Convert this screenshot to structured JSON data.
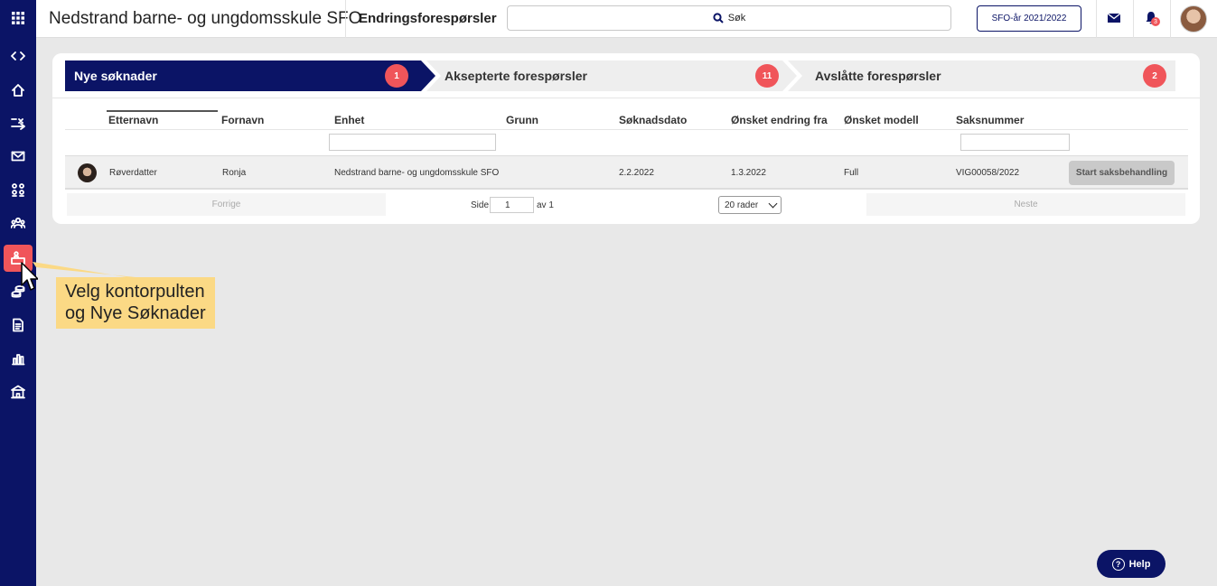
{
  "header": {
    "org_title": "Nedstrand barne- og ungdomsskule SFO",
    "page_title": "Endringsforespørsler",
    "search_label": "Søk",
    "year_button": "SFO-år 2021/2022",
    "notification_count": "3"
  },
  "sidebar": {
    "items": [
      {
        "icon": "apps-grid-icon"
      },
      {
        "icon": "code-brackets-icon"
      },
      {
        "icon": "home-icon"
      },
      {
        "icon": "shuffle-icon"
      },
      {
        "icon": "mail-icon"
      },
      {
        "icon": "groups-icon"
      },
      {
        "icon": "people-icon"
      },
      {
        "icon": "desk-icon",
        "active": true
      },
      {
        "icon": "coins-icon"
      },
      {
        "icon": "document-icon"
      },
      {
        "icon": "bar-chart-icon"
      },
      {
        "icon": "school-icon"
      }
    ]
  },
  "steps": [
    {
      "label": "Nye søknader",
      "count": "1"
    },
    {
      "label": "Aksepterte forespørsler",
      "count": "11"
    },
    {
      "label": "Avslåtte forespørsler",
      "count": "2"
    }
  ],
  "table": {
    "columns": [
      "Etternavn",
      "Fornavn",
      "Enhet",
      "Grunn",
      "Søknadsdato",
      "Ønsket endring fra",
      "Ønsket modell",
      "Saksnummer"
    ],
    "rows": [
      {
        "etternavn": "Røverdatter",
        "fornavn": "Ronja",
        "enhet": "Nedstrand barne- og ungdomsskule SFO",
        "grunn": "",
        "soknadsdato": "2.2.2022",
        "endring_fra": "1.3.2022",
        "modell": "Full",
        "saksnummer": "VIG00058/2022",
        "action": "Start saksbehandling"
      }
    ]
  },
  "pagination": {
    "prev": "Forrige",
    "page_label": "Side",
    "page_value": "1",
    "of_label": "av 1",
    "rows_select": "20 rader",
    "next": "Neste"
  },
  "callout": {
    "line1": "Velg kontorpulten",
    "line2": "og Nye Søknader"
  },
  "help": {
    "label": "Help"
  }
}
